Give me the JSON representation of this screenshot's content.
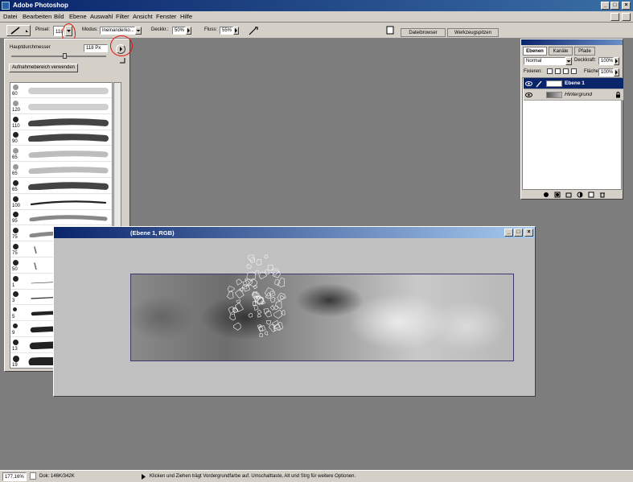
{
  "app": {
    "title": "Adobe Photoshop"
  },
  "window_buttons": {
    "minimize": "_",
    "maximize": "□",
    "close": "×"
  },
  "menu": [
    "Datei",
    "Bearbeiten",
    "Bild",
    "Ebene",
    "Auswahl",
    "Filter",
    "Ansicht",
    "Fenster",
    "Hilfe"
  ],
  "options": {
    "brush_label": "Pinsel:",
    "brush_size": "118",
    "mode_label": "Modus:",
    "mode_value": "Ineinanderko...",
    "opacity_label": "Deckkr.:",
    "opacity_value": "50%",
    "flow_label": "Fluss:",
    "flow_value": "55%",
    "tab_filebrowser": "Dateibrowser",
    "tab_toolpresets": "Werkzeugspitzen"
  },
  "brush_panel": {
    "diameter_label": "Hauptdurchmesser",
    "diameter_value": "118 Px",
    "sample_button": "Aufnahmebereich verwenden",
    "brushes": [
      {
        "size": "60",
        "style": "soft"
      },
      {
        "size": "120",
        "style": "soft"
      },
      {
        "size": "110",
        "style": "rope"
      },
      {
        "size": "90",
        "style": "rope"
      },
      {
        "size": "65",
        "style": "light"
      },
      {
        "size": "65",
        "style": "light"
      },
      {
        "size": "65",
        "style": "rope"
      },
      {
        "size": "100",
        "style": "line"
      },
      {
        "size": "95",
        "style": "wave"
      },
      {
        "size": "75",
        "style": "wave"
      },
      {
        "size": "75",
        "style": "mark"
      },
      {
        "size": "50",
        "style": "mark"
      },
      {
        "size": "1",
        "style": "thin"
      },
      {
        "size": "3",
        "style": "thin"
      },
      {
        "size": "5",
        "style": "solid"
      },
      {
        "size": "9",
        "style": "solid"
      },
      {
        "size": "13",
        "style": "solid"
      },
      {
        "size": "19",
        "style": "solid"
      }
    ]
  },
  "layers_panel": {
    "tabs": [
      "Ebenen",
      "Kanäle",
      "Pfade"
    ],
    "blend_mode": "Normal",
    "opacity_label": "Deckkraft:",
    "opacity_value": "100%",
    "lock_label": "Fixieren:",
    "fill_label": "Fläche:",
    "fill_value": "100%",
    "layers": [
      {
        "name": "Ebene 1",
        "selected": true
      },
      {
        "name": "Hintergrund",
        "selected": false
      }
    ]
  },
  "document": {
    "title": "(Ebene 1, RGB)"
  },
  "status": {
    "zoom": "177,16%",
    "doc_size": "Dok: 146K/342K",
    "hint": "Klicken und Ziehen trägt Vordergrundfarbe auf. Umschalttaste, Alt und Strg für weitere Optionen."
  },
  "colors": {
    "titlebar": "#0a246a",
    "chrome": "#d4d0c8",
    "workspace": "#7d7d7d",
    "selection": "#0a246a",
    "annotation": "#e01010"
  }
}
